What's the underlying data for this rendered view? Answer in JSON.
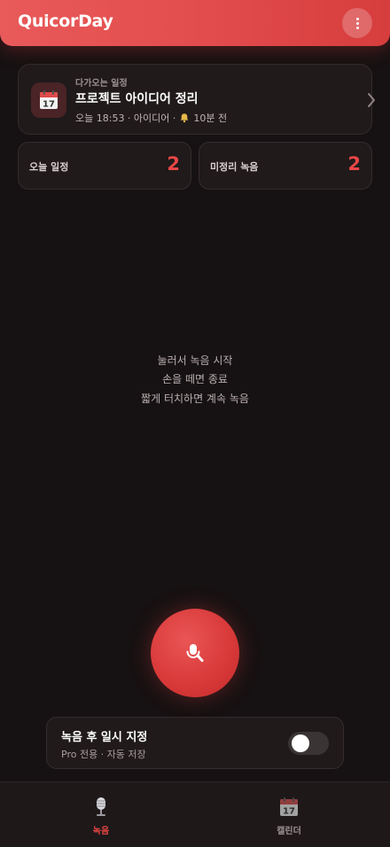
{
  "header": {
    "title": "QuicorDay",
    "menu_icon": "more-vertical-icon"
  },
  "upcoming": {
    "label": "다가오는 일정",
    "title": "프로젝트 아이디어 정리",
    "meta_time": "오늘 18:53 · 아이디어 · ",
    "meta_reminder": "10분 전",
    "icon": "calendar-icon",
    "calendar_day": "17"
  },
  "stats": {
    "today_label": "오늘 일정",
    "today_value": "2",
    "unsorted_label": "미정리 녹음",
    "unsorted_value": "2"
  },
  "hint": {
    "line1": "눌러서 녹음 시작",
    "line2": "손을 떼면 종료",
    "line3": "짧게 터치하면 계속 녹음"
  },
  "record_button": {
    "icon": "microphone-icon"
  },
  "pause_option": {
    "title": "녹음 후 일시 지정",
    "subtitle": "Pro 전용 · 자동 저장",
    "enabled": false
  },
  "nav": {
    "record_label": "녹음",
    "calendar_label": "캘린더",
    "active": "record"
  },
  "colors": {
    "accent": "#e84646",
    "background": "#161112",
    "card": "#201a1b"
  }
}
